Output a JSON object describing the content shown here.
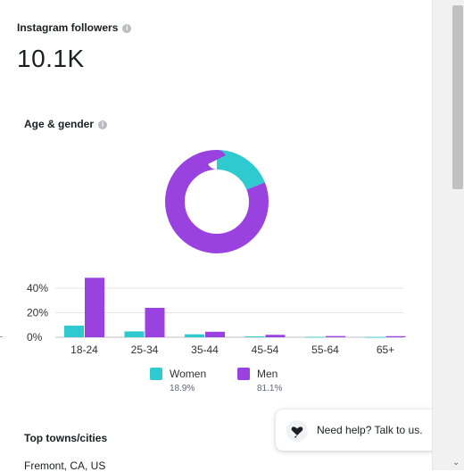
{
  "followers": {
    "title": "Instagram followers",
    "value": "10.1K"
  },
  "age_gender": {
    "title": "Age & gender"
  },
  "chart_data": {
    "type": "bar",
    "categories": [
      "18-24",
      "25-34",
      "35-44",
      "45-54",
      "55-64",
      "65+"
    ],
    "series": [
      {
        "name": "Women",
        "color": "#2ecad0",
        "values": [
          9.5,
          4.8,
          2.4,
          0.7,
          0.3,
          0.2
        ]
      },
      {
        "name": "Men",
        "color": "#9a42e0",
        "values": [
          48.5,
          24.0,
          4.5,
          2.0,
          1.0,
          0.9
        ]
      }
    ],
    "ylim": [
      0,
      50
    ],
    "yticks": [
      "0%",
      "20%",
      "40%"
    ],
    "ytick_values": [
      0,
      20,
      40
    ],
    "grid": true,
    "donut": {
      "segments": [
        {
          "name": "Women",
          "value": 18.9,
          "color": "#2ecad0"
        },
        {
          "name": "Men",
          "value": 81.1,
          "color": "#9a42e0"
        }
      ]
    },
    "legend": {
      "position": "bottom",
      "items": [
        {
          "name": "Women",
          "pct": "18.9%",
          "color": "#2ecad0"
        },
        {
          "name": "Men",
          "pct": "81.1%",
          "color": "#9a42e0"
        }
      ]
    }
  },
  "top_cities": {
    "title": "Top towns/cities",
    "first_city": "Fremont, CA, US"
  },
  "help": {
    "label": "Need help? Talk to us.",
    "icon": "heart-chat-icon"
  },
  "scrollbar": {
    "down_arrow": "⌄"
  }
}
